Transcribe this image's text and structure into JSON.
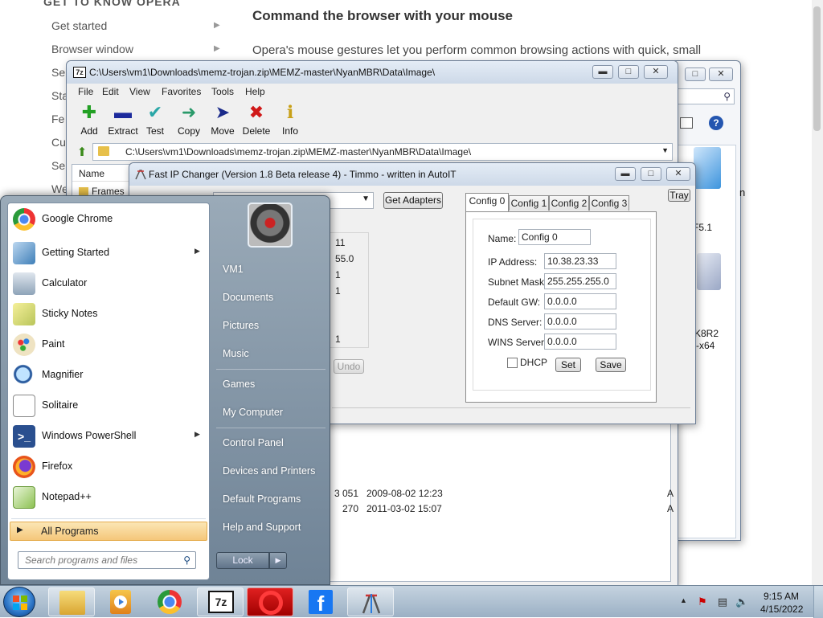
{
  "opera": {
    "nav_heading": "GET TO KNOW OPERA",
    "nav_items": [
      "Get started",
      "Browser window",
      "Se",
      "Sta",
      "Fe",
      "Cu",
      "Se",
      "We"
    ],
    "article_title": "Command the browser with your mouse",
    "article_text": "Opera's mouse gestures let you perform common browsing actions with quick, small"
  },
  "explorer_fragments": {
    "f1": "F5.1",
    "f2": "K8R2",
    "f3": "-x64",
    "f4": "n"
  },
  "zip": {
    "title": "C:\\Users\\vm1\\Downloads\\memz-trojan.zip\\MEMZ-master\\NyanMBR\\Data\\Image\\",
    "menu": [
      "File",
      "Edit",
      "View",
      "Favorites",
      "Tools",
      "Help"
    ],
    "toolbar": [
      {
        "label": "Add",
        "icon": "plus-icon",
        "color": "#22a024"
      },
      {
        "label": "Extract",
        "icon": "minus-icon",
        "color": "#1c2a9c"
      },
      {
        "label": "Test",
        "icon": "check-icon",
        "color": "#2aa7a7"
      },
      {
        "label": "Copy",
        "icon": "double-arrow-icon",
        "color": "#2a9a6a"
      },
      {
        "label": "Move",
        "icon": "arrow-right-icon",
        "color": "#1a2a8a"
      },
      {
        "label": "Delete",
        "icon": "x-icon",
        "color": "#d01818"
      },
      {
        "label": "Info",
        "icon": "info-icon",
        "color": "#c8a018"
      }
    ],
    "address": "C:\\Users\\vm1\\Downloads\\memz-trojan.zip\\MEMZ-master\\NyanMBR\\Data\\Image\\",
    "column_name": "Name",
    "row0": "Frames",
    "rows": [
      {
        "size": "3 051",
        "date": "2009-08-02 12:23",
        "attr": "A"
      },
      {
        "size": "270",
        "date": "2011-03-02 15:07",
        "attr": "A"
      }
    ]
  },
  "ipchanger": {
    "title": "Fast IP Changer (Version 1.8 Beta release 4) - Timmo - written in AutoIT",
    "get_adapters": "Get Adapters",
    "tray": "Tray",
    "undo": "Undo",
    "info_values": [
      "11",
      "55.0",
      "1",
      "1",
      "1"
    ],
    "tabs": [
      "Config 0",
      "Config 1",
      "Config 2",
      "Config 3"
    ],
    "fields": {
      "name_label": "Name:",
      "name_value": "Config 0",
      "ip_label": "IP Address:",
      "ip_value": "10.38.23.33",
      "mask_label": "Subnet Mask:",
      "mask_value": "255.255.255.0",
      "gw_label": "Default GW:",
      "gw_value": "0.0.0.0",
      "dns_label": "DNS Server:",
      "dns_value": "0.0.0.0",
      "wins_label": "WINS Server:",
      "wins_value": "0.0.0.0"
    },
    "dhcp": "DHCP",
    "set": "Set",
    "save": "Save"
  },
  "start_menu": {
    "programs": [
      {
        "label": "Google Chrome",
        "icon": "chrome-icon",
        "submenu": false
      },
      {
        "label": "Getting Started",
        "icon": "getting-started-icon",
        "submenu": true
      },
      {
        "label": "Calculator",
        "icon": "calculator-icon",
        "submenu": false
      },
      {
        "label": "Sticky Notes",
        "icon": "sticky-notes-icon",
        "submenu": false
      },
      {
        "label": "Paint",
        "icon": "paint-icon",
        "submenu": false
      },
      {
        "label": "Magnifier",
        "icon": "magnifier-icon",
        "submenu": false
      },
      {
        "label": "Solitaire",
        "icon": "solitaire-icon",
        "submenu": false
      },
      {
        "label": "Windows PowerShell",
        "icon": "powershell-icon",
        "submenu": true
      },
      {
        "label": "Firefox",
        "icon": "firefox-icon",
        "submenu": false
      },
      {
        "label": "Notepad++",
        "icon": "notepadpp-icon",
        "submenu": false
      }
    ],
    "all_programs": "All Programs",
    "search_placeholder": "Search programs and files",
    "right_items": [
      "VM1",
      "Documents",
      "Pictures",
      "Music",
      "Games",
      "My Computer",
      "Control Panel",
      "Devices and Printers",
      "Default Programs",
      "Help and Support"
    ],
    "lock": "Lock"
  },
  "taskbar": {
    "time": "9:15 AM",
    "date": "4/15/2022"
  }
}
